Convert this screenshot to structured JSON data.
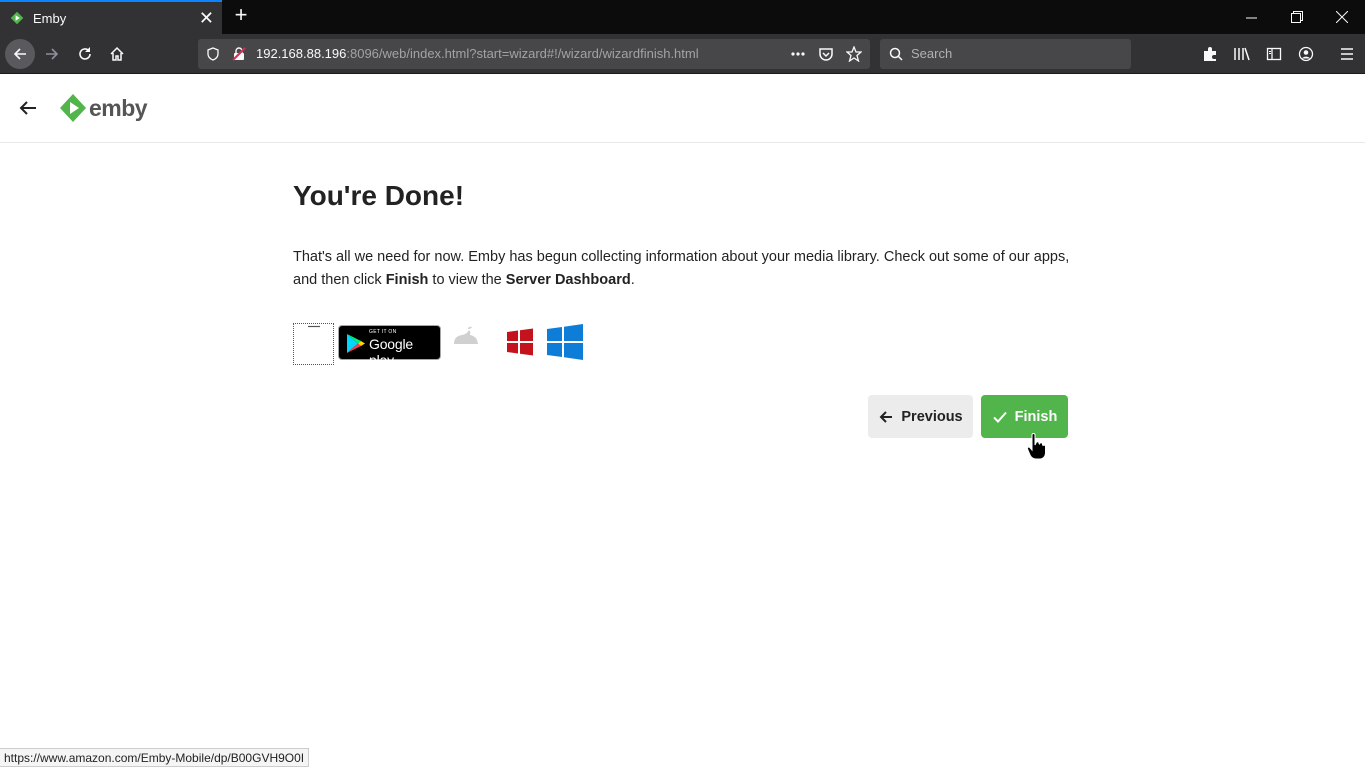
{
  "browser": {
    "tab_title": "Emby",
    "tab_close": "✕",
    "new_tab": "+",
    "url_host": "192.168.88.196",
    "url_rest": ":8096/web/index.html?start=wizard#!/wizard/wizardfinish.html",
    "search_placeholder": "Search",
    "status_url": "https://www.amazon.com/Emby-Mobile/dp/B00GVH9O0I"
  },
  "header": {
    "logo_text": "emby",
    "brand_color": "#52b54b"
  },
  "main": {
    "heading": "You're Done!",
    "para_part1": "That's all we need for now. Emby has begun collecting information about your media library. Check out some of our apps, and then click ",
    "para_bold1": "Finish",
    "para_part2": " to view the ",
    "para_bold2": "Server Dashboard",
    "para_part3": ".",
    "apps": {
      "gplay_small": "GET IT ON",
      "gplay_big": "Google play"
    }
  },
  "buttons": {
    "previous_label": "Previous",
    "finish_label": "Finish"
  }
}
